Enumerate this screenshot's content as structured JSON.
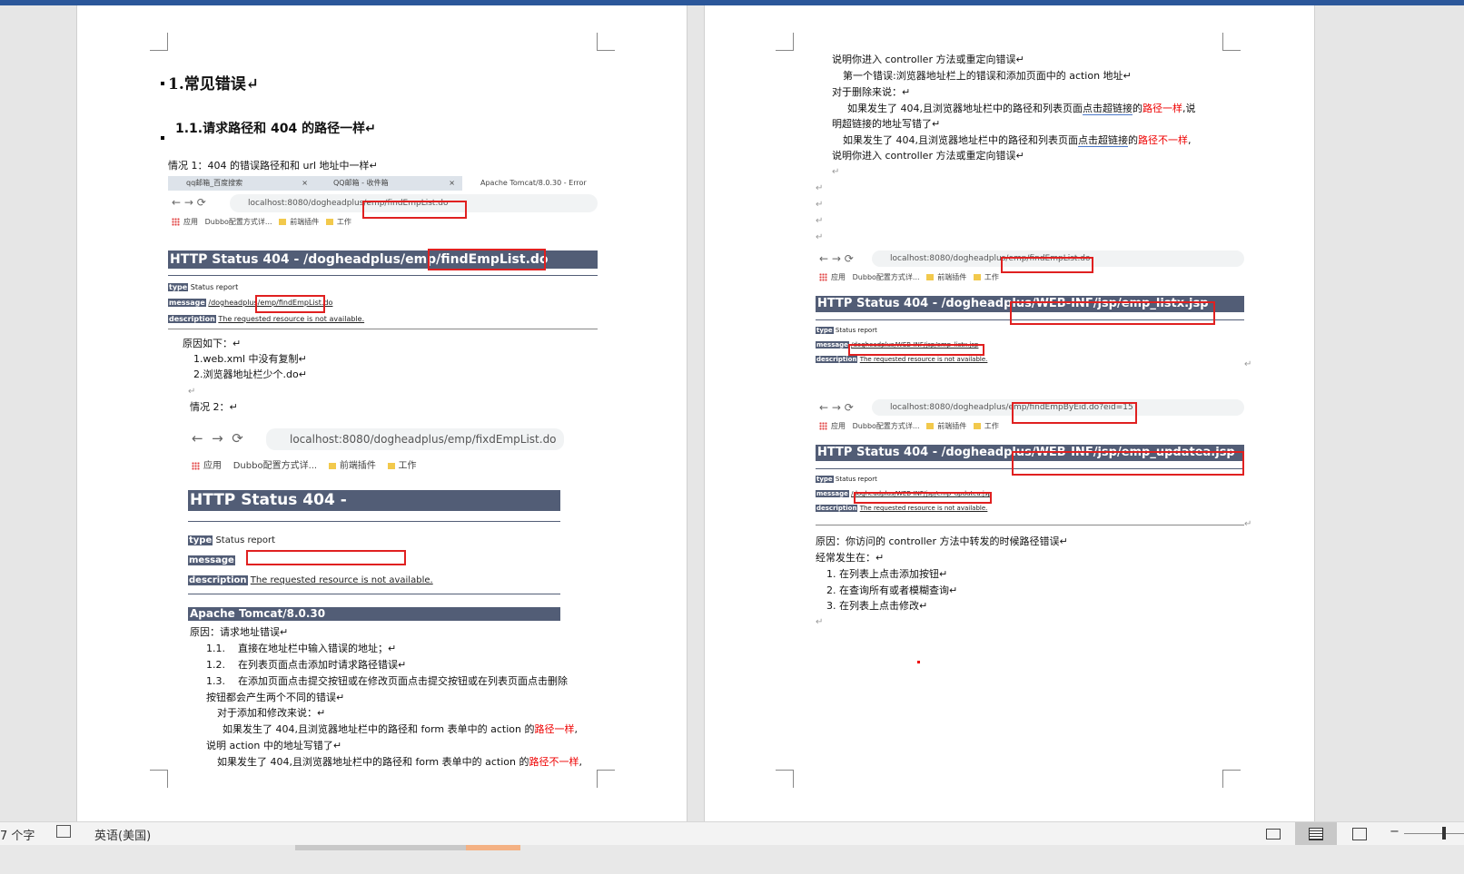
{
  "left_page": {
    "heading1": "1.常见错误↵",
    "heading2": "1.1.请求路径和 404 的路径一样↵",
    "case1": "情况 1：404 的错误路径和和 url 地址中一样↵",
    "shot1": {
      "tabs": [
        {
          "label": "qq邮箱_百度搜索",
          "close": "×"
        },
        {
          "label": "QQ邮箱 - 收件箱",
          "close": "×"
        },
        {
          "label": "Apache Tomcat/8.0.30 - Error",
          "close": ""
        }
      ],
      "url": "localhost:8080/dogheadplus/emp/findEmpList.do",
      "bookmarks": [
        "应用",
        "Dubbo配置方式详...",
        "前端插件",
        "工作"
      ],
      "status_title": "HTTP Status 404 - /dogheadplus/emp/findEmpList.do",
      "type_label": "type",
      "type_value": "Status report",
      "message_label": "message",
      "message_value": "/dogheadplus/emp/findEmpList.do",
      "description_label": "description",
      "description_value": "The requested resource is not available."
    },
    "reason_title": "原因如下：↵",
    "reasons": [
      "1.web.xml 中没有复制↵",
      "2.浏览器地址栏少个.do↵"
    ],
    "empty_para": "↵",
    "case2": "情况 2：↵",
    "shot2": {
      "url": "localhost:8080/dogheadplus/emp/fixdEmpList.do",
      "bookmarks": [
        "应用",
        "Dubbo配置方式详...",
        "前端插件",
        "工作"
      ],
      "status_title": "HTTP Status 404 -",
      "type_label": "type",
      "type_value": "Status report",
      "message_label": "message",
      "message_value": "",
      "description_label": "description",
      "description_value": "The requested resource is not available.",
      "footer": "Apache Tomcat/8.0.30"
    },
    "reason2": "原因：请求地址错误↵",
    "items": [
      {
        "num": "1.1.",
        "text": "直接在地址栏中输入错误的地址；↵"
      },
      {
        "num": "1.2.",
        "text": "在列表页面点击添加时请求路径错误↵"
      },
      {
        "num": "1.3.",
        "text": "在添加页面点击提交按钮或在修改页面点击提交按钮或在列表页面点击删除"
      }
    ],
    "item3_cont": "按钮都会产生两个不同的错误↵",
    "add_edit": "对于添加和修改来说：↵",
    "p1_a": "如果发生了 404,且浏览器地址栏中的路径和 form 表单中的 action 的",
    "p1_red": "路径一样",
    "p1_b": ",",
    "p1_c": "说明 action 中的地址写错了↵",
    "p2_a": "如果发生了 404,且浏览器地址栏中的路径和 form 表单中的 action 的",
    "p2_red": "路径不一样",
    "p2_b": ","
  },
  "right_page": {
    "l1": "说明你进入 controller 方法或重定向错误↵",
    "l2": "第一个错误:浏览器地址栏上的错误和添加页面中的 action 地址↵",
    "l3": "对于删除来说：↵",
    "l4_a": "如果发生了  404,且浏览器地址栏中的路径和列表页面",
    "l4_link": "点击超链接",
    "l4_b": "的",
    "l4_red": "路径一样",
    "l4_c": ",说",
    "l5": "明超链接的地址写错了↵",
    "l6_a": "如果发生了  404,且浏览器地址栏中的路径和列表页面",
    "l6_link": "点击超链接",
    "l6_b": "的",
    "l6_red": "路径不一样",
    "l6_c": ",",
    "l7": "说明你进入 controller 方法或重定向错误↵",
    "empty_para": "↵",
    "shot3": {
      "url": "localhost:8080/dogheadplus/emp/findEmpList.do",
      "bookmarks": [
        "应用",
        "Dubbo配置方式详...",
        "前端插件",
        "工作"
      ],
      "status_title": "HTTP Status 404 - /dogheadplus/WEB-INF/jsp/emp_listx.jsp",
      "type_label": "type",
      "type_value": "Status report",
      "message_label": "message",
      "message_value": "/dogheadplus/WEB-INF/jsp/emp_listx.jsp",
      "description_label": "description",
      "description_value": "The requested resource is not available."
    },
    "shot4": {
      "url": "localhost:8080/dogheadplus/emp/findEmpByEid.do?eid=15",
      "bookmarks": [
        "应用",
        "Dubbo配置方式详...",
        "前端插件",
        "工作"
      ],
      "status_title": "HTTP Status 404 - /dogheadplus/WEB-INF/jsp/emp_updatea.jsp",
      "type_label": "type",
      "type_value": "Status report",
      "message_label": "message",
      "message_value": "/dogheadplus/WEB-INF/jsp/emp_updatea.jsp",
      "description_label": "description",
      "description_value": "The requested resource is not available."
    },
    "reason": "原因：你访问的 controller 方法中转发的时候路径错误↵",
    "often": "经常发生在：↵",
    "list": [
      "1. 在列表上点击添加按钮↵",
      "2. 在查询所有或者模糊查询↵",
      "3. 在列表上点击修改↵"
    ]
  },
  "statusbar": {
    "word_count": "7 个字",
    "language": "英语(美国)",
    "zoom_minus": "−"
  },
  "colors": {
    "tomcat_header": "#525d76",
    "highlight_box": "#e02020",
    "red_text": "#ee0000",
    "word_blue": "#2b579a"
  }
}
